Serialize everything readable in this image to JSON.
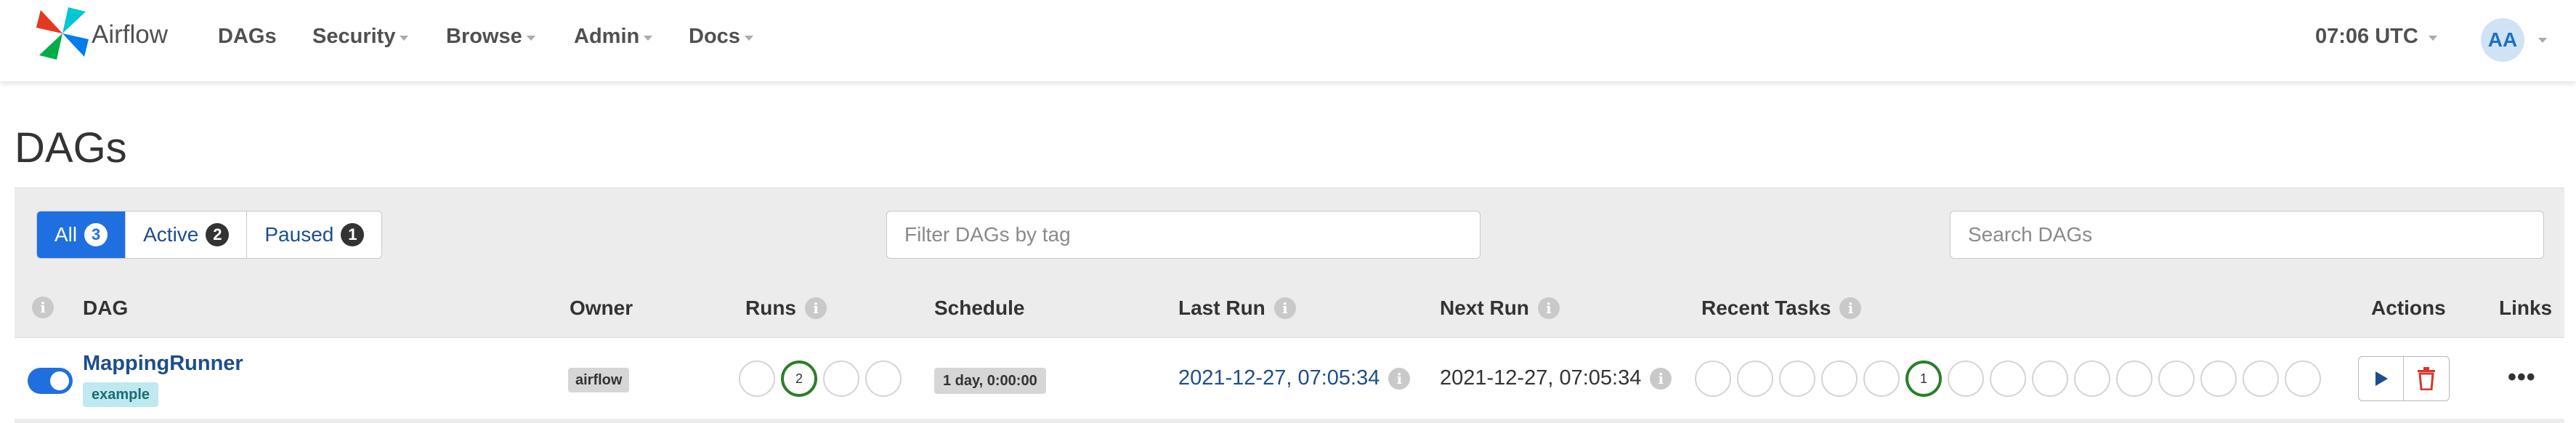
{
  "navbar": {
    "brand": "Airflow",
    "items": [
      {
        "label": "DAGs",
        "has_caret": false
      },
      {
        "label": "Security",
        "has_caret": true
      },
      {
        "label": "Browse",
        "has_caret": true
      },
      {
        "label": "Admin",
        "has_caret": true
      },
      {
        "label": "Docs",
        "has_caret": true
      }
    ],
    "clock": "07:06 UTC",
    "avatar_initials": "AA"
  },
  "page": {
    "title": "DAGs"
  },
  "filters": {
    "all": {
      "label": "All",
      "count": "3"
    },
    "active": {
      "label": "Active",
      "count": "2"
    },
    "paused": {
      "label": "Paused",
      "count": "1"
    },
    "tag_placeholder": "Filter DAGs by tag",
    "search_placeholder": "Search DAGs"
  },
  "table": {
    "headers": {
      "info": "i",
      "dag": "DAG",
      "owner": "Owner",
      "runs": "Runs",
      "schedule": "Schedule",
      "last_run": "Last Run",
      "next_run": "Next Run",
      "recent_tasks": "Recent Tasks",
      "actions": "Actions",
      "links": "Links"
    },
    "rows": [
      {
        "dag_id": "MappingRunner",
        "tag": "example",
        "owner": "airflow",
        "runs": [
          "",
          "2",
          "",
          ""
        ],
        "schedule": "1 day, 0:00:00",
        "last_run": "2021-12-27, 07:05:34",
        "next_run": "2021-12-27, 07:05:34",
        "recent_tasks": [
          "",
          "",
          "",
          "",
          "",
          "1",
          "",
          "",
          "",
          "",
          "",
          "",
          "",
          "",
          ""
        ],
        "links_label": "•••",
        "paused": false
      }
    ]
  },
  "colors": {
    "primary": "#1f6fe0",
    "link": "#1d4e89",
    "success": "#2a7f2a",
    "danger": "#d9362b"
  },
  "icons": {
    "trigger": "play-icon",
    "delete": "trash-icon",
    "links": "more-dots-icon"
  }
}
